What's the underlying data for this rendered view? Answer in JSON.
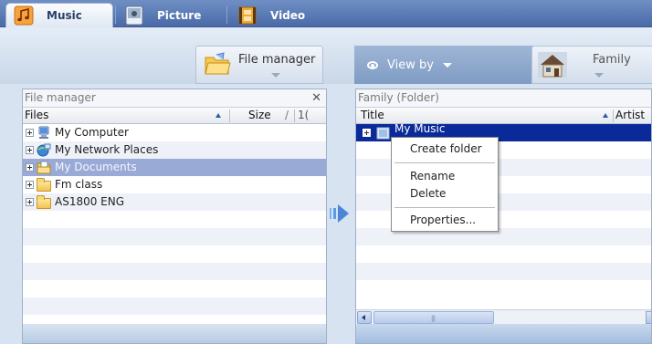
{
  "tabs": [
    {
      "label": "Music",
      "active": true,
      "icon": "music-note-icon"
    },
    {
      "label": "Picture",
      "active": false,
      "icon": "camera-icon"
    },
    {
      "label": "Video",
      "active": false,
      "icon": "film-strip-icon"
    }
  ],
  "toolbar": {
    "file_manager_label": "File manager",
    "view_by_label": "View by",
    "family_label": "Family"
  },
  "left_panel": {
    "title": "File manager",
    "columns": {
      "files": "Files",
      "size": "Size",
      "extra": "1("
    },
    "items": [
      {
        "label": "My Computer",
        "icon": "computer-icon"
      },
      {
        "label": "My Network Places",
        "icon": "network-places-icon"
      },
      {
        "label": "My Documents",
        "icon": "documents-folder-icon",
        "selected": true
      },
      {
        "label": "Fm class",
        "icon": "folder-icon"
      },
      {
        "label": "AS1800 ENG",
        "icon": "folder-icon"
      }
    ]
  },
  "right_panel": {
    "title": "Family (Folder)",
    "columns": {
      "title": "Title",
      "artist": "Artist"
    },
    "items": [
      {
        "label": "My Music",
        "icon": "music-folder-icon",
        "selected": true
      }
    ]
  },
  "context_menu": {
    "items": [
      "Create folder",
      "Rename",
      "Delete",
      "Properties..."
    ]
  },
  "colors": {
    "tab_bar": "#4a6aa8",
    "selection_dark": "#0a2a9a",
    "selection_light": "#9aaad6",
    "transfer_arrow": "#4a86d8"
  }
}
